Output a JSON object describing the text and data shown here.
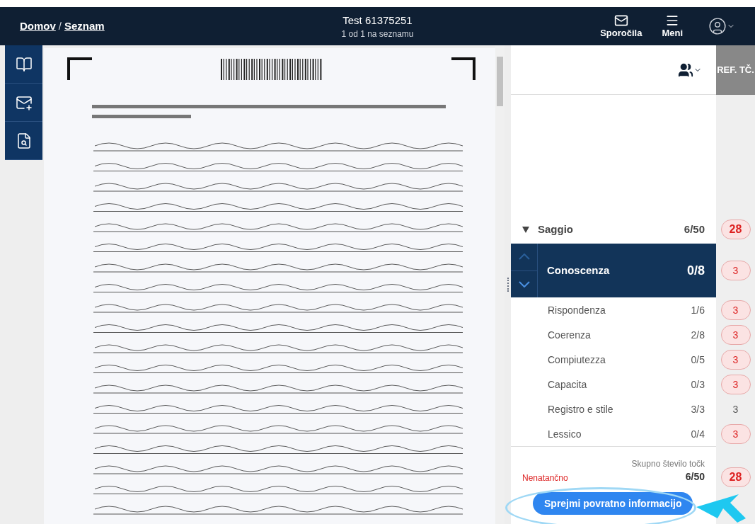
{
  "breadcrumb": [
    {
      "label": "Domov"
    },
    {
      "label": "Seznam"
    }
  ],
  "breadcrumb_separator": "/",
  "header": {
    "title": "Test 61375251",
    "subtitle": "1 od 1 na seznamu",
    "actions": [
      {
        "kind": "messages",
        "label": "Sporočila"
      },
      {
        "kind": "menu",
        "label": "Meni"
      }
    ]
  },
  "side_tools": [
    {
      "kind": "book"
    },
    {
      "kind": "mail"
    },
    {
      "kind": "search"
    }
  ],
  "ref_column": {
    "label": "REF. TČ."
  },
  "section": {
    "label": "Saggio",
    "expanded": true,
    "score": "6/50",
    "ref": "28",
    "flagged": true
  },
  "criteria": [
    {
      "label": "Conoscenza",
      "score": "0/8",
      "ref": "3",
      "flagged": true,
      "selected": true
    },
    {
      "label": "Rispondenza",
      "score": "1/6",
      "ref": "3",
      "flagged": true,
      "selected": false
    },
    {
      "label": "Coerenza",
      "score": "2/8",
      "ref": "3",
      "flagged": true,
      "selected": false
    },
    {
      "label": "Compiutezza",
      "score": "0/5",
      "ref": "3",
      "flagged": true,
      "selected": false
    },
    {
      "label": "Capacita",
      "score": "0/3",
      "ref": "3",
      "flagged": true,
      "selected": false
    },
    {
      "label": "Registro e stile",
      "score": "3/3",
      "ref": "3",
      "flagged": false,
      "selected": false
    },
    {
      "label": "Lessico",
      "score": "0/4",
      "ref": "3",
      "flagged": true,
      "selected": false
    }
  ],
  "total": {
    "label": "Skupno število točk",
    "status": "Nenatančno",
    "score": "6/50",
    "ref": "28",
    "flagged": true
  },
  "primary_button": {
    "label": "Sprejmi povratno informacijo"
  }
}
